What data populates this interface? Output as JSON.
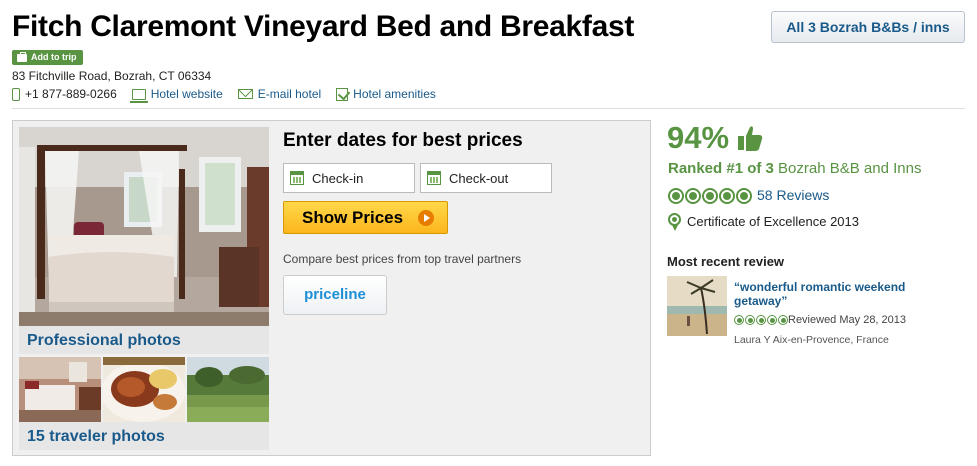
{
  "hotel": {
    "title": "Fitch Claremont Vineyard Bed and Breakfast",
    "add_trip_label": "Add to trip",
    "address": "83 Fitchville Road, Bozrah, CT 06334",
    "phone": "+1 877-889-0266",
    "links": {
      "website": "Hotel website",
      "email": "E-mail hotel",
      "amenities": "Hotel amenities"
    },
    "all_button": "All 3 Bozrah B&Bs / inns"
  },
  "photos": {
    "professional_label": "Professional photos",
    "traveler_label": "15 traveler photos"
  },
  "booking": {
    "heading": "Enter dates for best prices",
    "checkin_placeholder": "Check-in",
    "checkout_placeholder": "Check-out",
    "show_prices_label": "Show Prices",
    "compare_text": "Compare best prices from top travel partners",
    "partner_name": "priceline"
  },
  "rating": {
    "percent": "94%",
    "ranked_prefix": "Ranked #1 of 3",
    "ranked_suffix": " Bozrah B&B and Inns",
    "bubbles": 5,
    "reviews_count": "58 Reviews",
    "certificate": "Certificate of Excellence 2013"
  },
  "recent_review": {
    "heading": "Most recent review",
    "title": "“wonderful romantic weekend getaway”",
    "bubbles": 5,
    "date": "Reviewed May 28, 2013",
    "reviewer": "Laura Y Aix-en-Provence, France"
  },
  "colors": {
    "brand_green": "#589442",
    "link_blue": "#1a5a8a",
    "button_yellow": "#fcb61c"
  }
}
